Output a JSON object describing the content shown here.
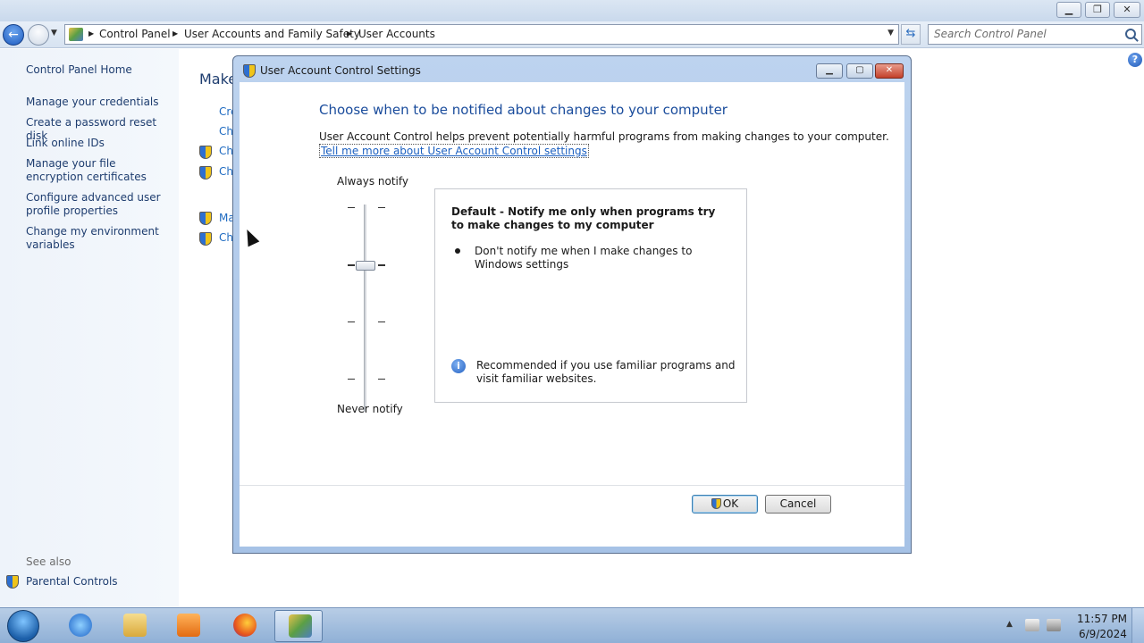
{
  "window": {
    "breadcrumbs": [
      "Control Panel",
      "User Accounts and Family Safety",
      "User Accounts"
    ],
    "search_placeholder": "Search Control Panel"
  },
  "sidebar": {
    "home": "Control Panel Home",
    "links": [
      "Manage your credentials",
      "Create a password reset disk",
      "Link online IDs",
      "Manage your file encryption certificates",
      "Configure advanced user profile properties",
      "Change my environment variables"
    ],
    "see_also": "See also",
    "parental": "Parental Controls"
  },
  "main": {
    "title_fragment": "Make",
    "link_fragments": [
      "Cre",
      "Ch",
      "Ch",
      "Ch",
      "Ma",
      "Ch"
    ]
  },
  "dialog": {
    "title": "User Account Control Settings",
    "heading": "Choose when to be notified about changes to your computer",
    "description": "User Account Control helps prevent potentially harmful programs from making changes to your computer.",
    "learn_more": "Tell me more about User Account Control settings",
    "slider": {
      "top_label": "Always notify",
      "bottom_label": "Never notify",
      "levels": 4,
      "selected_level": 2
    },
    "info": {
      "title": "Default - Notify me only when programs try to make changes to my computer",
      "bullet": "Don't notify me when I make changes to Windows settings",
      "recommendation": "Recommended if you use familiar programs and visit familiar websites."
    },
    "ok": "OK",
    "cancel": "Cancel"
  },
  "taskbar": {
    "time": "11:57 PM",
    "date": "6/9/2024"
  },
  "icons": {
    "help": "?",
    "info": "i"
  }
}
